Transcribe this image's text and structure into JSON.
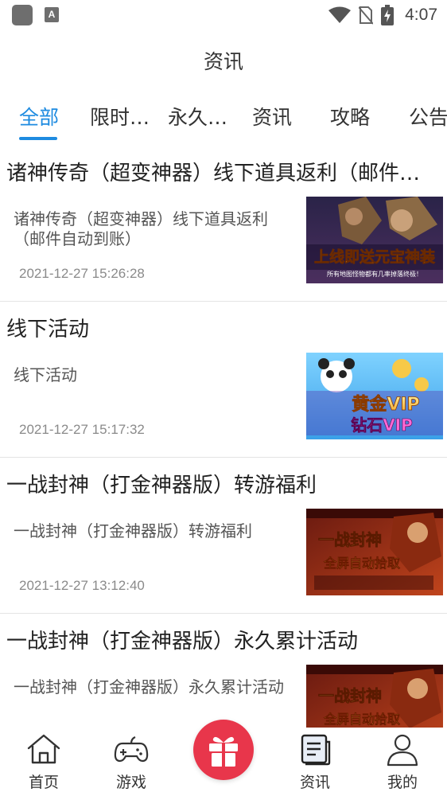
{
  "status_bar": {
    "time": "4:07",
    "app_icons": [
      "app-icon",
      "a-icon"
    ],
    "indicators": [
      "wifi-icon",
      "no-sim-icon",
      "battery-charging-icon"
    ]
  },
  "header": {
    "title": "资讯"
  },
  "tabs": [
    {
      "label": "全部",
      "active": true
    },
    {
      "label": "限时…",
      "active": false
    },
    {
      "label": "永久…",
      "active": false
    },
    {
      "label": "资讯",
      "active": false
    },
    {
      "label": "攻略",
      "active": false
    },
    {
      "label": "公告",
      "active": false
    }
  ],
  "accent_color": "#1e8be0",
  "articles": [
    {
      "title": "诸神传奇（超变神器）线下道具返利（邮件自动到账）",
      "desc": "诸神传奇（超变神器）线下道具返利（邮件自动到账）",
      "time": "2021-12-27 15:26:28",
      "thumb": {
        "caption": "上线即送元宝神装",
        "subcaption": "所有地图怪物都有几率掉落终极！"
      }
    },
    {
      "title": "线下活动",
      "desc": "线下活动",
      "time": "2021-12-27 15:17:32",
      "thumb": {
        "caption": "黄金VIP",
        "subcaption": "钻石VIP"
      }
    },
    {
      "title": "一战封神（打金神器版）转游福利",
      "desc": "一战封神（打金神器版）转游福利",
      "time": "2021-12-27 13:12:40",
      "thumb": {
        "caption": "一战封神",
        "subcaption": "全屏自动拾取"
      }
    },
    {
      "title": "一战封神（打金神器版）永久累计活动",
      "desc": "一战封神（打金神器版）永久累计活动",
      "time": "",
      "thumb": {
        "caption": "一战封神",
        "subcaption": "全屏自动拾取"
      }
    }
  ],
  "bottom_nav": {
    "items": [
      {
        "label": "首页",
        "icon": "home-icon"
      },
      {
        "label": "游戏",
        "icon": "gamepad-icon"
      },
      {
        "label": "",
        "icon": "gift-icon"
      },
      {
        "label": "资讯",
        "icon": "news-icon"
      },
      {
        "label": "我的",
        "icon": "user-icon"
      }
    ],
    "gift_color": "#e8364b"
  }
}
